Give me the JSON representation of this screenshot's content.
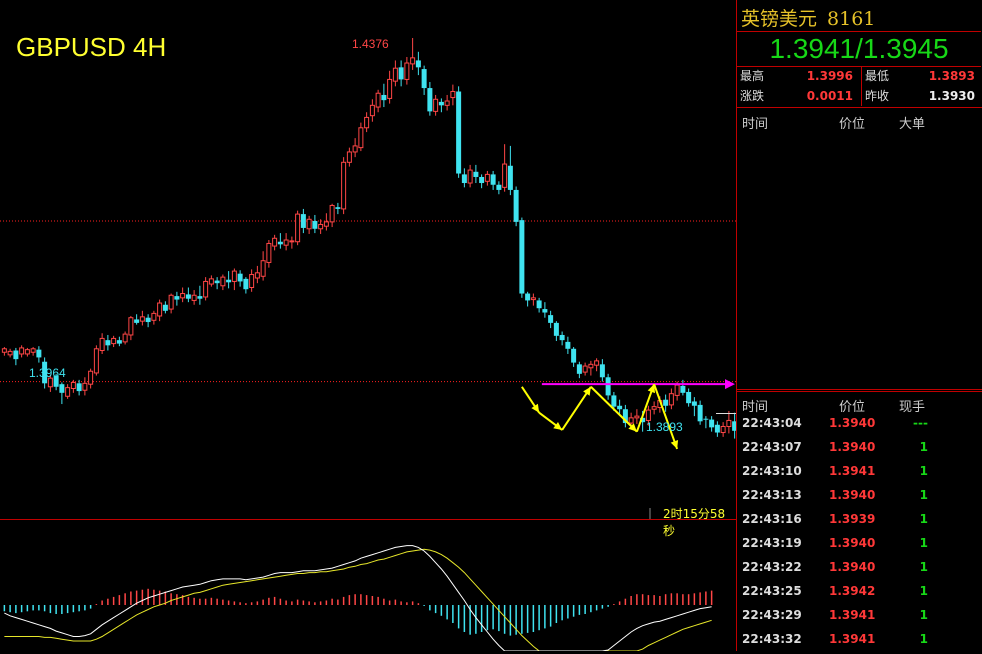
{
  "chart": {
    "title": "GBPUSD 4H",
    "high_label": "1.4376",
    "low_label_left": "1.3964",
    "low_label_right": "1.3893",
    "countdown": "2时15分58秒",
    "colors": {
      "up": "#ff4646",
      "down": "#3fe3f0",
      "macd_dif": "#ffffff",
      "macd_dea": "#e6e62a",
      "pattern": "#ffff00",
      "resistance": "#ff00ff",
      "dotted": "#ff2020"
    }
  },
  "chart_data": {
    "type": "candlestick",
    "ylim": [
      1.382,
      1.442
    ],
    "candles": [
      [
        1.4012,
        1.4016,
        1.4008,
        1.4018
      ],
      [
        1.4009,
        1.4013,
        1.4006,
        1.4016
      ],
      [
        1.4014,
        1.4004,
        1.3997,
        1.4017
      ],
      [
        1.401,
        1.4017,
        1.4006,
        1.402
      ],
      [
        1.401,
        1.4015,
        1.4007,
        1.4017
      ],
      [
        1.4012,
        1.4016,
        1.4008,
        1.4018
      ],
      [
        1.4015,
        1.4006,
        1.4,
        1.4019
      ],
      [
        1.4001,
        1.3976,
        1.397,
        1.4006
      ],
      [
        1.3972,
        1.3982,
        1.3966,
        1.3986
      ],
      [
        1.3985,
        1.3972,
        1.3968,
        1.3987
      ],
      [
        1.3975,
        1.3965,
        1.3952,
        1.3977
      ],
      [
        1.3961,
        1.3971,
        1.3958,
        1.3975
      ],
      [
        1.397,
        1.3977,
        1.3965,
        1.398
      ],
      [
        1.3976,
        1.3967,
        1.3962,
        1.398
      ],
      [
        1.3968,
        1.3976,
        1.3962,
        1.3983
      ],
      [
        1.3975,
        1.399,
        1.397,
        1.3993
      ],
      [
        1.3988,
        1.4016,
        1.3985,
        1.402
      ],
      [
        1.4014,
        1.4028,
        1.401,
        1.4034
      ],
      [
        1.4026,
        1.402,
        1.4014,
        1.4032
      ],
      [
        1.4022,
        1.4028,
        1.4018,
        1.4031
      ],
      [
        1.4026,
        1.4022,
        1.4019,
        1.403
      ],
      [
        1.4024,
        1.4033,
        1.4021,
        1.4036
      ],
      [
        1.4032,
        1.4052,
        1.4026,
        1.4054
      ],
      [
        1.405,
        1.4046,
        1.4044,
        1.4056
      ],
      [
        1.4048,
        1.4053,
        1.4043,
        1.406
      ],
      [
        1.4052,
        1.4047,
        1.4041,
        1.4056
      ],
      [
        1.4049,
        1.4057,
        1.4044,
        1.406
      ],
      [
        1.4054,
        1.4069,
        1.4048,
        1.4073
      ],
      [
        1.4067,
        1.406,
        1.4057,
        1.4071
      ],
      [
        1.4062,
        1.4078,
        1.4057,
        1.408
      ],
      [
        1.4077,
        1.4073,
        1.4066,
        1.4082
      ],
      [
        1.4075,
        1.408,
        1.407,
        1.4087
      ],
      [
        1.4079,
        1.4074,
        1.407,
        1.4087
      ],
      [
        1.4072,
        1.4078,
        1.4067,
        1.4084
      ],
      [
        1.4077,
        1.4074,
        1.4067,
        1.4089
      ],
      [
        1.4076,
        1.4094,
        1.4072,
        1.4099
      ],
      [
        1.4091,
        1.4097,
        1.4088,
        1.4101
      ],
      [
        1.4095,
        1.4092,
        1.4085,
        1.4099
      ],
      [
        1.4089,
        1.4099,
        1.4084,
        1.4102
      ],
      [
        1.4096,
        1.4093,
        1.4086,
        1.4106
      ],
      [
        1.4094,
        1.4106,
        1.4084,
        1.4109
      ],
      [
        1.4103,
        1.4094,
        1.4088,
        1.4107
      ],
      [
        1.4097,
        1.4085,
        1.408,
        1.4099
      ],
      [
        1.4087,
        1.4102,
        1.4082,
        1.4108
      ],
      [
        1.4098,
        1.4104,
        1.4092,
        1.4112
      ],
      [
        1.41,
        1.4118,
        1.4095,
        1.4129
      ],
      [
        1.4116,
        1.4138,
        1.411,
        1.4142
      ],
      [
        1.4135,
        1.4144,
        1.413,
        1.4148
      ],
      [
        1.414,
        1.4137,
        1.4132,
        1.415
      ],
      [
        1.4136,
        1.4142,
        1.413,
        1.415
      ],
      [
        1.414,
        1.4141,
        1.4132,
        1.4146
      ],
      [
        1.414,
        1.4172,
        1.4136,
        1.4176
      ],
      [
        1.4172,
        1.4156,
        1.415,
        1.4178
      ],
      [
        1.4155,
        1.4166,
        1.4149,
        1.417
      ],
      [
        1.4164,
        1.4155,
        1.415,
        1.4171
      ],
      [
        1.4155,
        1.416,
        1.4149,
        1.4166
      ],
      [
        1.4158,
        1.4163,
        1.4153,
        1.4173
      ],
      [
        1.4163,
        1.4182,
        1.4157,
        1.4184
      ],
      [
        1.418,
        1.4178,
        1.4172,
        1.4185
      ],
      [
        1.4178,
        1.4232,
        1.4172,
        1.4238
      ],
      [
        1.4232,
        1.4244,
        1.4227,
        1.4249
      ],
      [
        1.4244,
        1.4251,
        1.4238,
        1.426
      ],
      [
        1.4249,
        1.4272,
        1.4245,
        1.4278
      ],
      [
        1.4272,
        1.4284,
        1.4267,
        1.429
      ],
      [
        1.4286,
        1.4298,
        1.4279,
        1.4305
      ],
      [
        1.4296,
        1.4312,
        1.429,
        1.4316
      ],
      [
        1.431,
        1.4304,
        1.4296,
        1.4323
      ],
      [
        1.4306,
        1.4328,
        1.43,
        1.4338
      ],
      [
        1.4326,
        1.4341,
        1.432,
        1.435
      ],
      [
        1.4342,
        1.4328,
        1.432,
        1.435
      ],
      [
        1.4328,
        1.4347,
        1.4322,
        1.4354
      ],
      [
        1.4346,
        1.4353,
        1.4339,
        1.4376
      ],
      [
        1.435,
        1.4342,
        1.4333,
        1.436
      ],
      [
        1.434,
        1.4318,
        1.431,
        1.4344
      ],
      [
        1.4318,
        1.4291,
        1.4286,
        1.4325
      ],
      [
        1.4291,
        1.4305,
        1.4286,
        1.431
      ],
      [
        1.4302,
        1.4298,
        1.429,
        1.4306
      ],
      [
        1.4298,
        1.4303,
        1.4292,
        1.431
      ],
      [
        1.4307,
        1.4314,
        1.4298,
        1.4322
      ],
      [
        1.4314,
        1.4219,
        1.4214,
        1.432
      ],
      [
        1.4218,
        1.4208,
        1.4203,
        1.4225
      ],
      [
        1.4208,
        1.4223,
        1.4203,
        1.4229
      ],
      [
        1.4221,
        1.4215,
        1.4208,
        1.4229
      ],
      [
        1.4215,
        1.4208,
        1.4202,
        1.4218
      ],
      [
        1.421,
        1.4218,
        1.4205,
        1.4222
      ],
      [
        1.4218,
        1.4206,
        1.42,
        1.4222
      ],
      [
        1.4206,
        1.42,
        1.4195,
        1.421
      ],
      [
        1.4203,
        1.423,
        1.4198,
        1.4253
      ],
      [
        1.4228,
        1.42,
        1.4194,
        1.4251
      ],
      [
        1.42,
        1.4163,
        1.4158,
        1.4204
      ],
      [
        1.4165,
        1.408,
        1.4075,
        1.4168
      ],
      [
        1.408,
        1.4072,
        1.4065,
        1.4082
      ],
      [
        1.4073,
        1.4075,
        1.4066,
        1.408
      ],
      [
        1.4072,
        1.4063,
        1.4058,
        1.4075
      ],
      [
        1.4062,
        1.4058,
        1.4052,
        1.407
      ],
      [
        1.4055,
        1.4046,
        1.404,
        1.406
      ],
      [
        1.4046,
        1.4031,
        1.4025,
        1.4048
      ],
      [
        1.4032,
        1.4026,
        1.402,
        1.4036
      ],
      [
        1.4024,
        1.4016,
        1.401,
        1.403
      ],
      [
        1.4016,
        1.4,
        1.3995,
        1.4018
      ],
      [
        1.3998,
        1.3987,
        1.3982,
        1.4001
      ],
      [
        1.3989,
        1.3996,
        1.3985,
        1.4
      ],
      [
        1.3994,
        1.3998,
        1.3985,
        1.4002
      ],
      [
        1.3997,
        1.4002,
        1.399,
        1.4005
      ],
      [
        1.3998,
        1.3983,
        1.3978,
        1.4004
      ],
      [
        1.3983,
        1.3962,
        1.3957,
        1.3987
      ],
      [
        1.3962,
        1.3949,
        1.3944,
        1.3966
      ],
      [
        1.395,
        1.3946,
        1.3941,
        1.3957
      ],
      [
        1.3946,
        1.393,
        1.3925,
        1.3951
      ],
      [
        1.393,
        1.3936,
        1.3928,
        1.3942
      ],
      [
        1.3936,
        1.3938,
        1.3929,
        1.3946
      ],
      [
        1.3936,
        1.3931,
        1.392,
        1.3944
      ],
      [
        1.3933,
        1.3945,
        1.3927,
        1.395
      ],
      [
        1.3946,
        1.3949,
        1.394,
        1.3955
      ],
      [
        1.3948,
        1.3956,
        1.3942,
        1.3961
      ],
      [
        1.3957,
        1.395,
        1.3943,
        1.3963
      ],
      [
        1.3951,
        1.3964,
        1.3946,
        1.397
      ],
      [
        1.3962,
        1.3974,
        1.3956,
        1.3978
      ],
      [
        1.3973,
        1.3965,
        1.3962,
        1.398
      ],
      [
        1.3966,
        1.3953,
        1.3949,
        1.397
      ],
      [
        1.3955,
        1.395,
        1.3938,
        1.396
      ],
      [
        1.3951,
        1.3932,
        1.3928,
        1.3956
      ],
      [
        1.3935,
        1.3934,
        1.3924,
        1.3938
      ],
      [
        1.3934,
        1.3925,
        1.392,
        1.3938
      ],
      [
        1.3928,
        1.3919,
        1.3914,
        1.3932
      ],
      [
        1.3919,
        1.3926,
        1.3914,
        1.3931
      ],
      [
        1.3926,
        1.3933,
        1.3918,
        1.3944
      ],
      [
        1.3932,
        1.3921,
        1.3912,
        1.3942
      ],
      [
        1.3921,
        1.3918,
        1.3893,
        1.3932
      ],
      [
        1.3918,
        1.393,
        1.3905,
        1.3935
      ],
      [
        1.3941,
        1.3975,
        1.3933,
        1.3985
      ],
      [
        1.3975,
        1.3943,
        1.3936,
        1.3977
      ]
    ],
    "resistance_level": 1.3975,
    "dotted_levels": [
      1.4164,
      1.3978
    ],
    "pattern_points": [
      [
        90,
        1.3972
      ],
      [
        93,
        1.3942
      ],
      [
        97,
        1.3922
      ],
      [
        102,
        1.3972
      ],
      [
        110,
        1.392
      ],
      [
        113,
        1.3975
      ],
      [
        117,
        1.39
      ]
    ],
    "current_price_marker": 1.3941,
    "macd": {
      "hist": [
        -0.7,
        -0.8,
        -0.9,
        -0.8,
        -0.7,
        -0.6,
        -0.6,
        -0.7,
        -0.9,
        -1.0,
        -1.0,
        -0.9,
        -0.8,
        -0.7,
        -0.6,
        -0.4,
        0.1,
        0.5,
        0.7,
        0.9,
        1.1,
        1.3,
        1.5,
        1.6,
        1.7,
        1.8,
        1.7,
        1.6,
        1.5,
        1.3,
        1.2,
        1.1,
        0.9,
        0.8,
        0.7,
        0.7,
        0.8,
        0.7,
        0.6,
        0.5,
        0.4,
        0.3,
        0.2,
        0.3,
        0.4,
        0.6,
        0.8,
        0.9,
        0.7,
        0.5,
        0.4,
        0.6,
        0.5,
        0.4,
        0.3,
        0.4,
        0.5,
        0.7,
        0.6,
        0.9,
        1.1,
        1.2,
        1.2,
        1.1,
        1.0,
        0.9,
        0.7,
        0.5,
        0.6,
        0.4,
        0.3,
        0.4,
        0.2,
        -0.1,
        -0.6,
        -0.9,
        -1.2,
        -1.6,
        -2.0,
        -2.6,
        -3.0,
        -3.3,
        -3.2,
        -3.0,
        -2.8,
        -2.7,
        -2.9,
        -3.2,
        -3.4,
        -3.3,
        -3.2,
        -3.1,
        -3.0,
        -2.8,
        -2.6,
        -2.4,
        -2.0,
        -1.7,
        -1.5,
        -1.3,
        -1.1,
        -1.0,
        -0.8,
        -0.6,
        -0.4,
        -0.2,
        0.1,
        0.4,
        0.7,
        1.0,
        1.2,
        1.2,
        1.1,
        1.1,
        1.0,
        1.2,
        1.3,
        1.3,
        1.2,
        1.2,
        1.3,
        1.4,
        1.5,
        1.6
      ],
      "dif": [
        -0.9,
        -1.2,
        -1.4,
        -1.6,
        -1.8,
        -2.0,
        -2.2,
        -2.4,
        -2.6,
        -2.9,
        -3.1,
        -3.3,
        -3.5,
        -3.5,
        -3.4,
        -3.2,
        -2.7,
        -2.2,
        -1.8,
        -1.4,
        -1.0,
        -0.6,
        -0.2,
        0.2,
        0.5,
        0.8,
        1.0,
        1.2,
        1.4,
        1.6,
        1.8,
        2.0,
        2.1,
        2.2,
        2.3,
        2.5,
        2.7,
        2.8,
        2.9,
        2.9,
        2.9,
        2.9,
        2.8,
        2.9,
        3.0,
        3.1,
        3.3,
        3.5,
        3.6,
        3.6,
        3.6,
        3.7,
        3.8,
        3.8,
        3.8,
        3.9,
        4.0,
        4.1,
        4.3,
        4.5,
        4.7,
        4.9,
        5.2,
        5.4,
        5.6,
        5.8,
        6.0,
        6.2,
        6.4,
        6.5,
        6.6,
        6.6,
        6.4,
        6.0,
        5.4,
        4.7,
        4.0,
        3.2,
        2.3,
        1.4,
        0.5,
        -0.5,
        -1.4,
        -2.2,
        -3.0,
        -3.8,
        -4.5,
        -5.2,
        -5.9,
        -6.5,
        -7.0,
        -7.4,
        -7.7,
        -7.9,
        -8.0,
        -8.0,
        -7.9,
        -7.7,
        -7.5,
        -7.2,
        -6.9,
        -6.6,
        -6.2,
        -5.8,
        -5.4,
        -5.0,
        -4.5,
        -4.0,
        -3.5,
        -3.0,
        -2.6,
        -2.3,
        -2.1,
        -1.9,
        -1.8,
        -1.6,
        -1.4,
        -1.2,
        -1.0,
        -0.8,
        -0.6,
        -0.4,
        -0.3,
        -0.2
      ],
      "dea": [
        -3.5,
        -3.5,
        -3.5,
        -3.5,
        -3.5,
        -3.5,
        -3.5,
        -3.6,
        -3.6,
        -3.7,
        -3.8,
        -3.9,
        -4.0,
        -4.0,
        -4.0,
        -4.0,
        -3.8,
        -3.5,
        -3.1,
        -2.7,
        -2.3,
        -1.9,
        -1.5,
        -1.1,
        -0.8,
        -0.5,
        -0.2,
        0.0,
        0.2,
        0.5,
        0.7,
        0.9,
        1.1,
        1.3,
        1.4,
        1.6,
        1.8,
        2.0,
        2.2,
        2.3,
        2.4,
        2.5,
        2.6,
        2.7,
        2.8,
        2.9,
        3.0,
        3.1,
        3.2,
        3.3,
        3.4,
        3.5,
        3.5,
        3.6,
        3.6,
        3.7,
        3.7,
        3.8,
        3.9,
        4.0,
        4.2,
        4.3,
        4.5,
        4.6,
        4.8,
        5.0,
        5.1,
        5.3,
        5.5,
        5.7,
        5.9,
        6.0,
        6.1,
        6.2,
        6.1,
        5.9,
        5.6,
        5.2,
        4.7,
        4.2,
        3.6,
        2.9,
        2.2,
        1.5,
        0.8,
        0.1,
        -0.6,
        -1.3,
        -2.0,
        -2.7,
        -3.4,
        -4.0,
        -4.6,
        -5.1,
        -5.6,
        -6.0,
        -6.4,
        -6.7,
        -7.0,
        -7.2,
        -7.4,
        -7.5,
        -7.5,
        -7.4,
        -7.3,
        -7.1,
        -6.8,
        -6.5,
        -6.1,
        -5.7,
        -5.3,
        -4.9,
        -4.5,
        -4.2,
        -3.9,
        -3.6,
        -3.3,
        -3.0,
        -2.7,
        -2.5,
        -2.3,
        -2.1,
        -1.9,
        -1.7
      ]
    }
  },
  "panel": {
    "symbol_name": "英镑美元",
    "symbol_code": "8161",
    "quote": "1.3941/1.3945",
    "stats": {
      "high_label": "最高",
      "high_value": "1.3996",
      "low_label": "最低",
      "low_value": "1.3893",
      "change_label": "涨跌",
      "change_value": "0.0011",
      "prevclose_label": "昨收",
      "prevclose_value": "1.3930"
    },
    "big_trades_headers": {
      "time": "时间",
      "price": "价位",
      "size": "大单"
    },
    "ticks_headers": {
      "time": "时间",
      "price": "价位",
      "size": "现手"
    },
    "ticks": [
      {
        "time": "22:43:04",
        "price": "1.3940",
        "size": "---"
      },
      {
        "time": "22:43:07",
        "price": "1.3940",
        "size": "1"
      },
      {
        "time": "22:43:10",
        "price": "1.3941",
        "size": "1"
      },
      {
        "time": "22:43:13",
        "price": "1.3940",
        "size": "1"
      },
      {
        "time": "22:43:16",
        "price": "1.3939",
        "size": "1"
      },
      {
        "time": "22:43:19",
        "price": "1.3940",
        "size": "1"
      },
      {
        "time": "22:43:22",
        "price": "1.3940",
        "size": "1"
      },
      {
        "time": "22:43:25",
        "price": "1.3942",
        "size": "1"
      },
      {
        "time": "22:43:29",
        "price": "1.3941",
        "size": "1"
      },
      {
        "time": "22:43:32",
        "price": "1.3941",
        "size": "1"
      }
    ]
  }
}
